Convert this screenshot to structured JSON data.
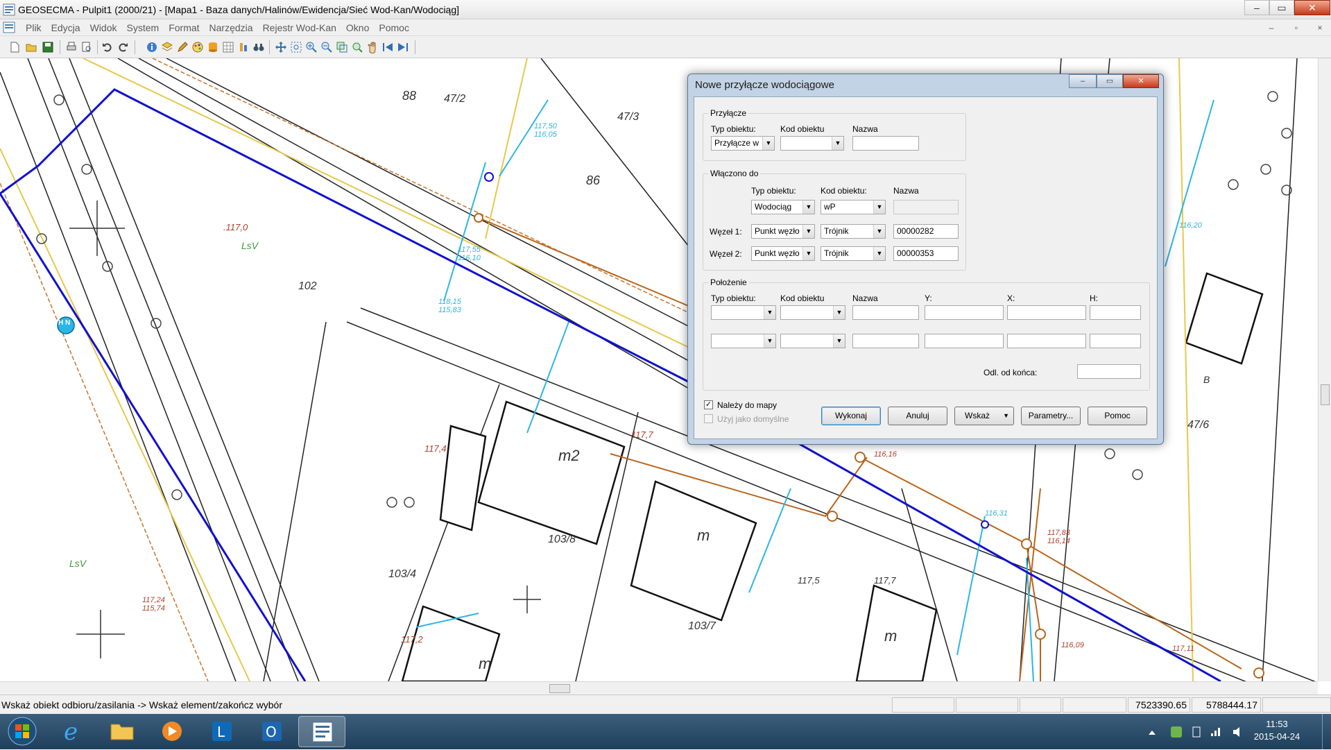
{
  "window": {
    "title": "GEOSECMA - Pulpit1 (2000/21) - [Mapa1 - Baza danych/Halinów/Ewidencja/Sieć Wod-Kan/Wodociąg]",
    "minimize": "‒",
    "maximize": "▭",
    "close": "✕"
  },
  "menu": {
    "items": [
      "Plik",
      "Edycja",
      "Widok",
      "System",
      "Format",
      "Narzędzia",
      "Rejestr Wod-Kan",
      "Okno",
      "Pomoc"
    ],
    "mdi_minimize": "–",
    "mdi_restore": "▫",
    "mdi_close": "×"
  },
  "map": {
    "labels": {
      "parcel_102": "102",
      "lsv_1": "LsV",
      "lsv_2": "LsV",
      "h117_0": ".117,0",
      "p88": "88",
      "p47_2": "47/2",
      "p47_3": "47/3",
      "p86": "86",
      "m2": "m2",
      "m_1": "m",
      "m_2": "m",
      "m_3": "m",
      "m_4": "m",
      "p103_8": "103/8",
      "p103_4": "103/4",
      "p103_7": "103/7",
      "h117_4": "117,4",
      "h117_7": "117,7",
      "h117_5": "117,5",
      "h117_7b": "117,7",
      "h117_2": "117,2",
      "p47_6": "47/6",
      "b_label": "B",
      "hn": "H N",
      "h117_55": "117,55",
      "h116_10": "116,10",
      "h118_15": "118,15",
      "h115_83": "115,83",
      "h117_50": "117,50",
      "h116_05": "116,05",
      "h117_24": "117,24",
      "h115_74": "115,74",
      "h116_16": "116,16",
      "h116_31": "116,31",
      "h116_14": "116,14",
      "h116_20": "116,20",
      "h116_09": "116,09",
      "h117_83": "117,83",
      "h117_11": "117,11"
    }
  },
  "dialog": {
    "title": "Nowe przyłącze wodociągowe",
    "przylacze": {
      "group_title": "Przyłącze",
      "typ_label": "Typ obiektu:",
      "kod_label": "Kod obiektu",
      "nazwa_label": "Nazwa",
      "typ_value": "Przyłącze w",
      "kod_value": "",
      "nazwa_value": ""
    },
    "wlaczono": {
      "group_title": "Włączono do",
      "typ_label": "Typ obiektu:",
      "kod_label": "Kod obiektu:",
      "nazwa_label": "Nazwa",
      "typ_value": "Wodociąg",
      "kod_value": "wP",
      "nazwa_value": "",
      "wezel1_label": "Węzeł 1:",
      "wezel1_typ": "Punkt węzło",
      "wezel1_kod": "Trójnik",
      "wezel1_nazwa": "00000282",
      "wezel2_label": "Węzeł 2:",
      "wezel2_typ": "Punkt węzło",
      "wezel2_kod": "Trójnik",
      "wezel2_nazwa": "00000353"
    },
    "polozenie": {
      "group_title": "Położenie",
      "typ_label": "Typ obiektu:",
      "kod_label": "Kod obiektu",
      "nazwa_label": "Nazwa",
      "y_label": "Y:",
      "x_label": "X:",
      "h_label": "H:",
      "odl_label": "Odl. od końca:",
      "odl_value": ""
    },
    "nalezy_do_mapy": "Należy do mapy",
    "nalezy_checked": "✓",
    "uzyj_domyslne": "Użyj jako domyślne",
    "buttons": {
      "wykonaj": "Wykonaj",
      "anuluj": "Anuluj",
      "wskaz": "Wskaż",
      "parametry": "Parametry...",
      "pomoc": "Pomoc"
    }
  },
  "statusbar": {
    "message": "Wskaż obiekt odbioru/zasilania -> Wskaż element/zakończ wybór",
    "coord_y": "7523390.65",
    "coord_x": "5788444.17"
  },
  "taskbar": {
    "time": "11:53",
    "date": "2015-04-24"
  },
  "colors": {
    "water_main": "#1010d0",
    "connection": "#2ab6e6",
    "sewer": "#b8651c",
    "map_label": "#333333",
    "lsv": "#3a9a3a",
    "height_label": "#b0402a"
  }
}
